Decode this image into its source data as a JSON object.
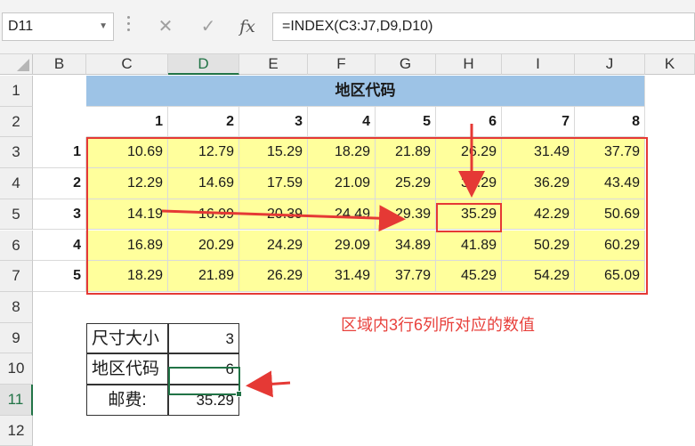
{
  "formula_bar": {
    "name_box": "D11",
    "cancel_icon": "✕",
    "enter_icon": "✓",
    "fx_label": "fx",
    "formula": "=INDEX(C3:J7,D9,D10)"
  },
  "columns": [
    "B",
    "C",
    "D",
    "E",
    "F",
    "G",
    "H",
    "I",
    "J",
    "K"
  ],
  "selected_column": "D",
  "rows": [
    "1",
    "2",
    "3",
    "4",
    "5",
    "6",
    "7",
    "8",
    "9",
    "10",
    "11",
    "12"
  ],
  "selected_row": "11",
  "sheet": {
    "title": "地区代码",
    "col_index": [
      "1",
      "2",
      "3",
      "4",
      "5",
      "6",
      "7",
      "8"
    ],
    "row_index": [
      "1",
      "2",
      "3",
      "4",
      "5"
    ],
    "matrix": [
      [
        "10.69",
        "12.79",
        "15.29",
        "18.29",
        "21.89",
        "26.29",
        "31.49",
        "37.79"
      ],
      [
        "12.29",
        "14.69",
        "17.59",
        "21.09",
        "25.29",
        "30.29",
        "36.29",
        "43.49"
      ],
      [
        "14.19",
        "16.99",
        "20.39",
        "24.49",
        "29.39",
        "35.29",
        "42.29",
        "50.69"
      ],
      [
        "16.89",
        "20.29",
        "24.29",
        "29.09",
        "34.89",
        "41.89",
        "50.29",
        "60.29"
      ],
      [
        "18.29",
        "21.89",
        "26.29",
        "31.49",
        "37.79",
        "45.29",
        "54.29",
        "65.09"
      ]
    ],
    "lookup": [
      {
        "label": "尺寸大小",
        "value": "3"
      },
      {
        "label": "地区代码",
        "value": "6"
      },
      {
        "label": "邮费:",
        "value": "35.29"
      }
    ]
  },
  "annotation": "区域内3行6列所对应的数值",
  "colors": {
    "header_fill": "#9dc3e6",
    "data_fill": "#ffff9c",
    "highlight_red": "#e53935",
    "excel_green": "#217346"
  }
}
